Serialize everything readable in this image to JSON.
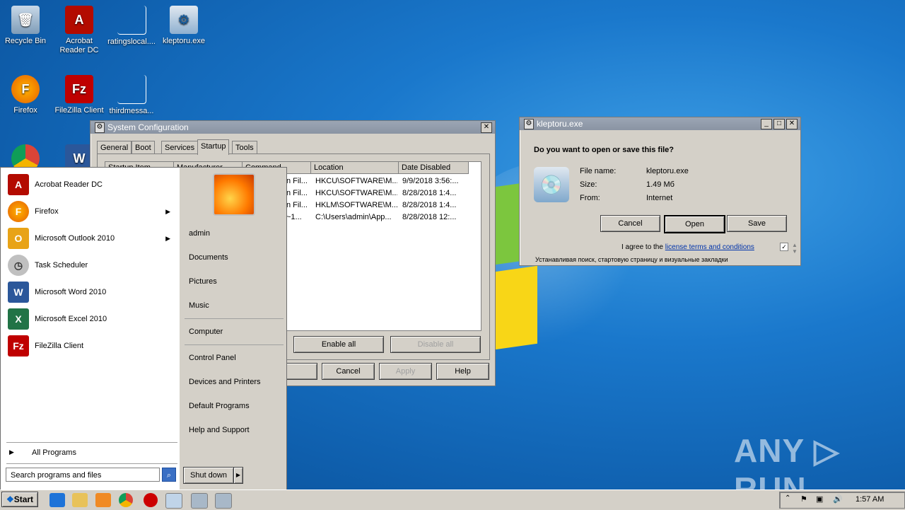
{
  "desktop": {
    "icons": [
      {
        "label": "Recycle Bin",
        "icon": "recycle-bin-icon"
      },
      {
        "label": "Acrobat Reader DC",
        "icon": "acrobat-icon"
      },
      {
        "label": "ratingslocal....",
        "icon": "file-icon"
      },
      {
        "label": "kleptoru.exe",
        "icon": "installer-icon"
      },
      {
        "label": "Firefox",
        "icon": "firefox-icon"
      },
      {
        "label": "FileZilla Client",
        "icon": "filezilla-icon"
      },
      {
        "label": "thirdmessa...",
        "icon": "file-icon"
      }
    ],
    "watermark": "ANY ▷ RUN"
  },
  "sysconfig": {
    "title": "System Configuration",
    "tabs": [
      "General",
      "Boot",
      "Services",
      "Startup",
      "Tools"
    ],
    "columns": [
      "Startup Item",
      "Manufacturer",
      "Command",
      "Location",
      "Date Disabled"
    ],
    "rows": [
      {
        "command": "n Fil...",
        "location": "HKCU\\SOFTWARE\\M...",
        "date": "9/9/2018 3:56:..."
      },
      {
        "command": "n Fil...",
        "location": "HKCU\\SOFTWARE\\M...",
        "date": "8/28/2018 1:4..."
      },
      {
        "command": "n Fil...",
        "location": "HKLM\\SOFTWARE\\M...",
        "date": "8/28/2018 1:4..."
      },
      {
        "command": "~1...",
        "location": "C:\\Users\\admin\\App...",
        "date": "8/28/2018 12:..."
      }
    ],
    "enable_all": "Enable all",
    "disable_all": "Disable all",
    "ok": "OK",
    "cancel": "Cancel",
    "apply": "Apply",
    "help": "Help"
  },
  "download": {
    "title": "kleptoru.exe",
    "question": "Do you want to open or save this file?",
    "name_label": "File name:",
    "name_value": "kleptoru.exe",
    "size_label": "Size:",
    "size_value": "1.49 Мб",
    "from_label": "From:",
    "from_value": "Internet",
    "cancel": "Cancel",
    "open": "Open",
    "save": "Save",
    "agree_prefix": "I agree to the",
    "agree_link": "license terms and conditions",
    "install_text": "Устанавливая поиск, стартовую страницу и визуальные закладки"
  },
  "startmenu": {
    "programs": [
      {
        "label": "Acrobat Reader DC",
        "color": "#b30b00",
        "glyph": "A",
        "arrow": false
      },
      {
        "label": "Firefox",
        "color": "#e66000",
        "glyph": "F",
        "arrow": true
      },
      {
        "label": "Microsoft Outlook 2010",
        "color": "#e8a317",
        "glyph": "O",
        "arrow": true
      },
      {
        "label": "Task Scheduler",
        "color": "#8a8a8a",
        "glyph": "◷",
        "arrow": false
      },
      {
        "label": "Microsoft Word 2010",
        "color": "#2b579a",
        "glyph": "W",
        "arrow": false
      },
      {
        "label": "Microsoft Excel 2010",
        "color": "#217346",
        "glyph": "X",
        "arrow": false
      },
      {
        "label": "FileZilla Client",
        "color": "#bf0000",
        "glyph": "Fz",
        "arrow": false
      }
    ],
    "all_programs": "All Programs",
    "search_placeholder": "Search programs and files",
    "right_items": [
      "admin",
      "Documents",
      "Pictures",
      "Music",
      "Computer",
      "Control Panel",
      "Devices and Printers",
      "Default Programs",
      "Help and Support"
    ],
    "shutdown": "Shut down"
  },
  "taskbar": {
    "start": "Start",
    "clock": "1:57 AM"
  }
}
